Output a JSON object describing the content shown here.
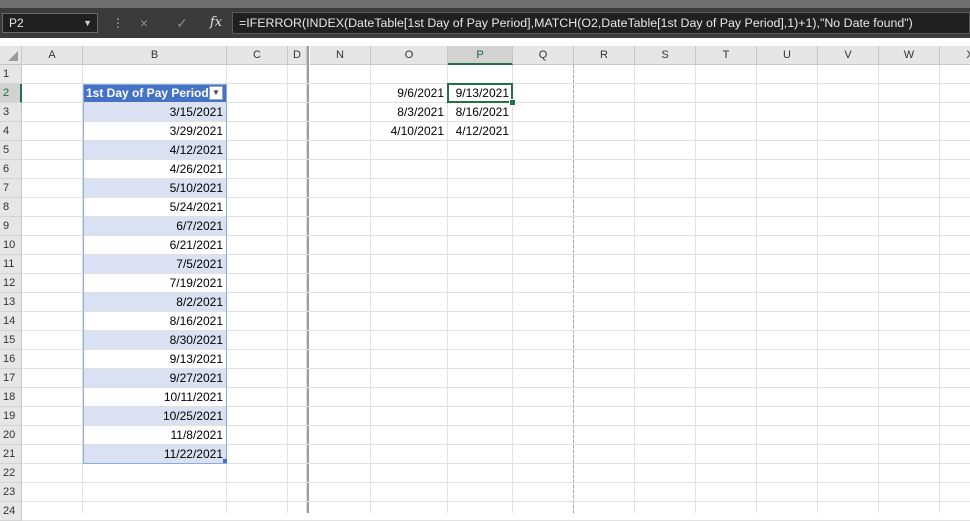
{
  "formula_bar": {
    "name_box": "P2",
    "cancel_icon": "×",
    "enter_icon": "✓",
    "fx_label": "fx",
    "formula": "=IFERROR(INDEX(DateTable[1st Day of Pay Period],MATCH(O2,DateTable[1st Day of Pay Period],1)+1),\"No Date found\")"
  },
  "columns": [
    "A",
    "B",
    "C",
    "D",
    "N",
    "O",
    "P",
    "Q",
    "R",
    "S",
    "T",
    "U",
    "V",
    "W",
    "X"
  ],
  "rows": [
    "1",
    "2",
    "3",
    "4",
    "5",
    "6",
    "7",
    "8",
    "9",
    "10",
    "11",
    "12",
    "13",
    "14",
    "15",
    "16",
    "17",
    "18",
    "19",
    "20",
    "21",
    "22",
    "23",
    "24"
  ],
  "selected_cell": {
    "column": "P",
    "row": "2"
  },
  "table": {
    "name": "DateTable",
    "header": "1st Day of Pay Period",
    "values": [
      "3/15/2021",
      "3/29/2021",
      "4/12/2021",
      "4/26/2021",
      "5/10/2021",
      "5/24/2021",
      "6/7/2021",
      "6/21/2021",
      "7/5/2021",
      "7/19/2021",
      "8/2/2021",
      "8/16/2021",
      "8/30/2021",
      "9/13/2021",
      "9/27/2021",
      "10/11/2021",
      "10/25/2021",
      "11/8/2021",
      "11/22/2021"
    ]
  },
  "lookup": {
    "inputs": [
      "9/6/2021",
      "8/3/2021",
      "4/10/2021"
    ],
    "results": [
      "9/13/2021",
      "8/16/2021",
      "4/12/2021"
    ]
  },
  "colors": {
    "table_header": "#4472c4",
    "table_band": "#d9e1f2",
    "selection": "#217346"
  }
}
